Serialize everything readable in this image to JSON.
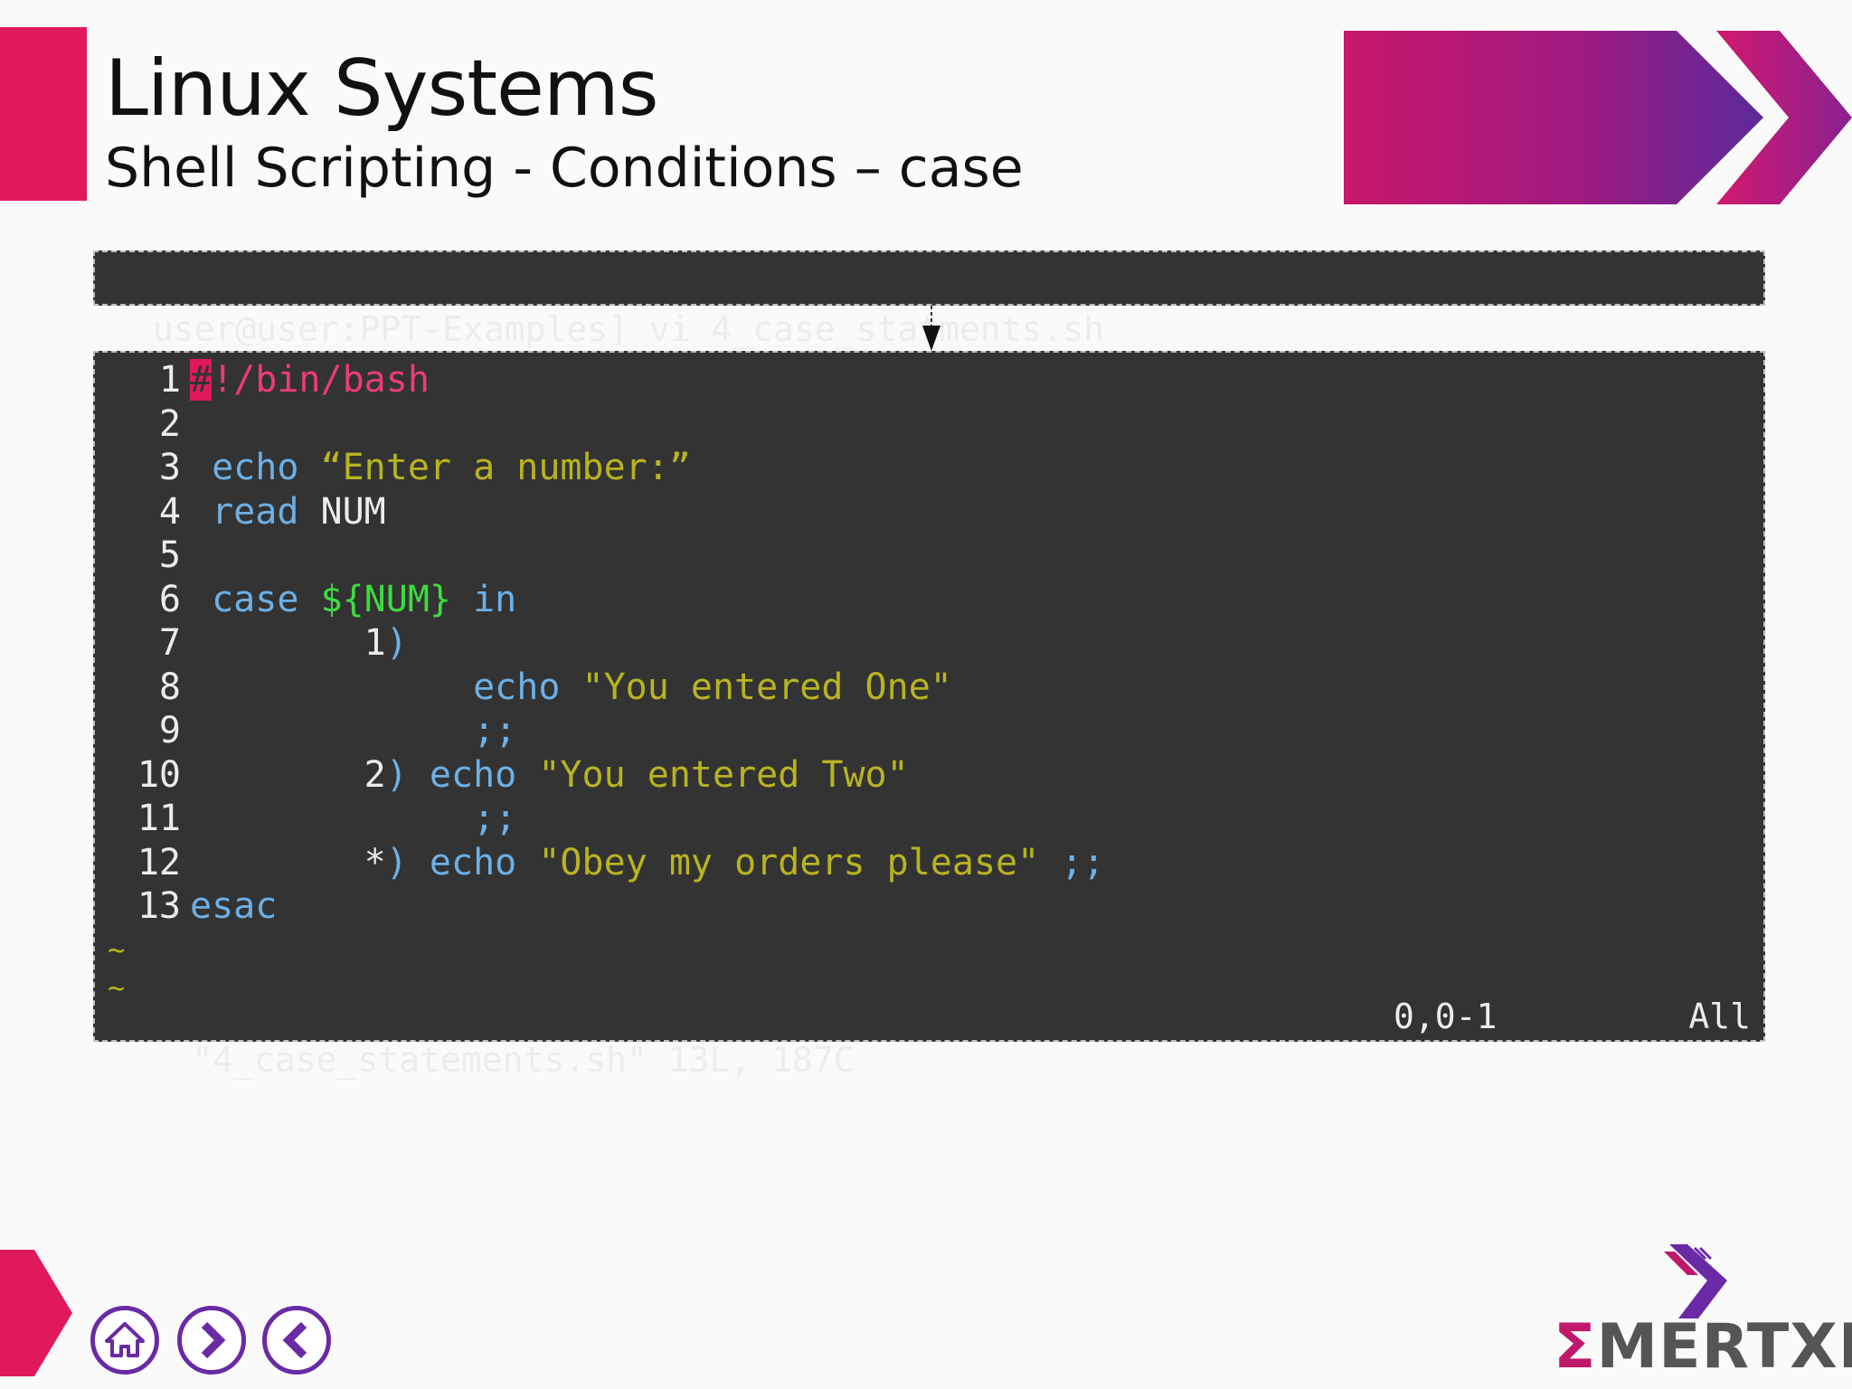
{
  "header": {
    "title": "Linux Systems",
    "subtitle": "Shell Scripting - Conditions – case"
  },
  "command": {
    "text": "user@user:PPT-Examples] vi 4_case_statments.sh"
  },
  "editor": {
    "lines": [
      {
        "n": "1",
        "parts": [
          [
            "hash",
            "#"
          ],
          [
            "shebang",
            "!/bin/bash"
          ]
        ]
      },
      {
        "n": "2",
        "parts": []
      },
      {
        "n": "3",
        "parts": [
          [
            "kw",
            " echo "
          ],
          [
            "str",
            "“Enter a number:”"
          ]
        ]
      },
      {
        "n": "4",
        "parts": [
          [
            "kw",
            " read "
          ],
          [
            "plain",
            "NUM"
          ]
        ]
      },
      {
        "n": "5",
        "parts": []
      },
      {
        "n": "6",
        "parts": [
          [
            "kw",
            " case "
          ],
          [
            "var",
            "${NUM}"
          ],
          [
            "kw",
            " in"
          ]
        ]
      },
      {
        "n": "7",
        "parts": [
          [
            "plain",
            "        1"
          ],
          [
            "kw",
            ")"
          ]
        ]
      },
      {
        "n": "8",
        "parts": [
          [
            "kw",
            "             echo "
          ],
          [
            "str",
            "\"You entered One\""
          ]
        ]
      },
      {
        "n": "9",
        "parts": [
          [
            "kw",
            "             ;;"
          ]
        ]
      },
      {
        "n": "10",
        "parts": [
          [
            "plain",
            "        2"
          ],
          [
            "kw",
            ") echo "
          ],
          [
            "str",
            "\"You entered Two\""
          ]
        ]
      },
      {
        "n": "11",
        "parts": [
          [
            "kw",
            "             ;;"
          ]
        ]
      },
      {
        "n": "12",
        "parts": [
          [
            "plain",
            "        *"
          ],
          [
            "kw",
            ") echo "
          ],
          [
            "str",
            "\"Obey my orders please\""
          ],
          [
            "kw",
            " ;;"
          ]
        ]
      },
      {
        "n": "13",
        "parts": [
          [
            "kw",
            "esac"
          ]
        ]
      }
    ],
    "tildes": [
      "~",
      "~"
    ],
    "status": {
      "file": "\"4_case_statements.sh\" 13L, 187C",
      "position": "0,0-1",
      "scroll": "All"
    }
  },
  "footer": {
    "logo": "MERTXE",
    "logo_sigma": "Σ",
    "nav": [
      "home-icon",
      "next-icon",
      "previous-icon"
    ]
  },
  "colors": {
    "accent": "#e0195f",
    "purple": "#6a2aa6",
    "terminal_bg": "#333333",
    "keyword": "#6cb0e6",
    "string": "#b8b420",
    "variable": "#3ddc3d"
  }
}
